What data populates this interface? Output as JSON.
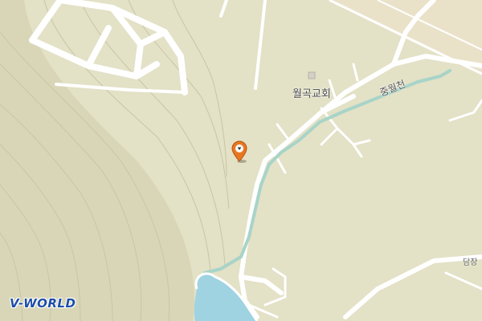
{
  "map": {
    "poi_label": "월곡교회",
    "stream_label": "중월천",
    "road_label": "담장",
    "brand": "V-WORLD"
  },
  "marker": {
    "icon": "location-pin-icon",
    "color": "#e87722"
  },
  "colors": {
    "land": "#e3e1c6",
    "hill": "#d9d6b8",
    "contour": "#c9c5a6",
    "road": "#ffffff",
    "water": "#9fd3e2",
    "stream": "#a8d4c8",
    "highway_bg": "#e9e2c9",
    "brand": "#1d4fa8"
  }
}
